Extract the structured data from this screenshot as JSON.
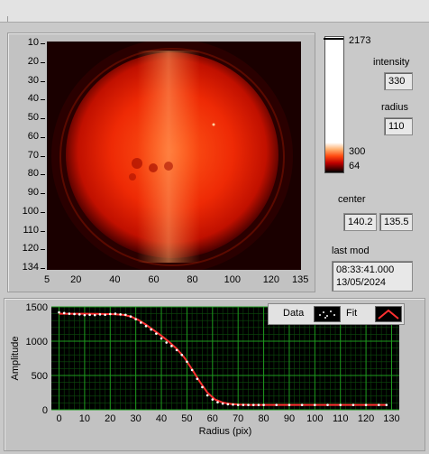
{
  "image_panel": {
    "y_ticks": [
      "10",
      "20",
      "30",
      "40",
      "50",
      "60",
      "70",
      "80",
      "90",
      "100",
      "110",
      "120",
      "134"
    ],
    "x_ticks": [
      "5",
      "20",
      "40",
      "60",
      "80",
      "100",
      "120",
      "135"
    ]
  },
  "colorbar": {
    "max_label": "2173",
    "mid_label": "300",
    "min_label": "64",
    "colors": [
      "#ffffff",
      "#ff9f55",
      "#ff2a00",
      "#7a0000",
      "#000000"
    ]
  },
  "intensity": {
    "label": "intensity",
    "value": "330"
  },
  "radius": {
    "label": "radius",
    "value": "110"
  },
  "center": {
    "label": "center",
    "x": "140.2",
    "y": "135.5"
  },
  "last_mod": {
    "label": "last mod",
    "time": "08:33:41.000",
    "date": "13/05/2024"
  },
  "legend": {
    "data_label": "Data",
    "fit_label": "Fit"
  },
  "chart_data": {
    "type": "scatter",
    "xlabel": "Radius (pix)",
    "ylabel": "Amplitude",
    "xlim": [
      -3,
      133
    ],
    "ylim": [
      0,
      1500
    ],
    "x_ticks": [
      0,
      10,
      20,
      30,
      40,
      50,
      60,
      70,
      80,
      90,
      100,
      110,
      120,
      130
    ],
    "y_ticks": [
      0,
      500,
      1000,
      1500
    ],
    "grid": true,
    "legend_position": "top-right",
    "background": "#000000",
    "grid_color": "#1e9a1e",
    "series": [
      {
        "name": "Data",
        "style": "points",
        "color": "#ffffff",
        "x": [
          0,
          2,
          4,
          6,
          8,
          10,
          12,
          14,
          16,
          18,
          20,
          22,
          24,
          26,
          28,
          30,
          32,
          34,
          36,
          38,
          40,
          42,
          44,
          46,
          48,
          50,
          52,
          54,
          56,
          58,
          60,
          62,
          64,
          66,
          68,
          70,
          72,
          74,
          76,
          78,
          80,
          85,
          90,
          95,
          100,
          105,
          110,
          115,
          120,
          125,
          128
        ],
        "y": [
          1420,
          1410,
          1400,
          1395,
          1390,
          1380,
          1385,
          1380,
          1390,
          1385,
          1395,
          1400,
          1390,
          1385,
          1360,
          1320,
          1270,
          1220,
          1170,
          1110,
          1040,
          980,
          930,
          870,
          800,
          700,
          580,
          450,
          330,
          210,
          150,
          110,
          90,
          80,
          75,
          70,
          70,
          70,
          70,
          70,
          70,
          70,
          70,
          70,
          70,
          70,
          70,
          70,
          70,
          70,
          70
        ]
      },
      {
        "name": "Fit",
        "style": "line",
        "color": "#ff3030",
        "x": [
          0,
          5,
          10,
          15,
          20,
          25,
          28,
          31,
          34,
          37,
          40,
          43,
          46,
          49,
          52,
          55,
          58,
          61,
          64,
          67,
          70,
          75,
          80,
          90,
          100,
          110,
          120,
          128
        ],
        "y": [
          1400,
          1400,
          1400,
          1398,
          1395,
          1385,
          1360,
          1310,
          1240,
          1160,
          1080,
          990,
          890,
          760,
          590,
          410,
          250,
          150,
          105,
          85,
          75,
          70,
          70,
          70,
          70,
          70,
          70,
          70
        ]
      }
    ]
  }
}
